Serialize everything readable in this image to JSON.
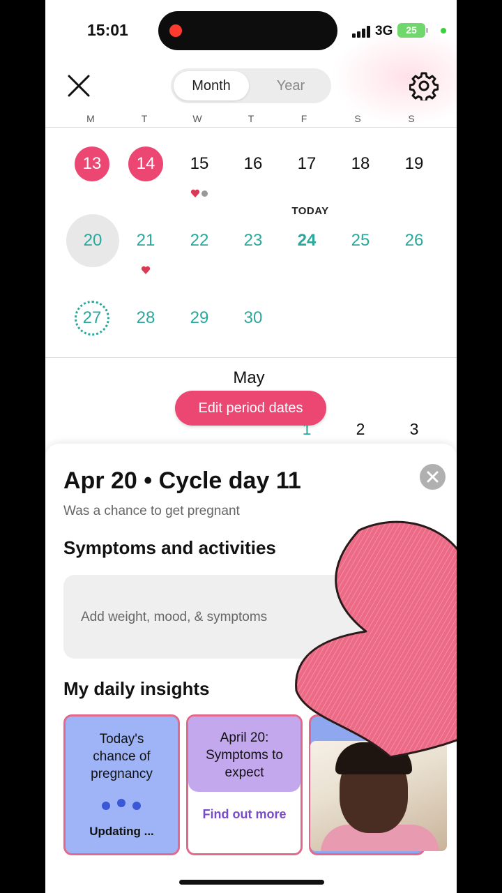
{
  "status": {
    "time": "15:01",
    "network": "3G",
    "battery": "25"
  },
  "header": {
    "close_icon": "close-icon",
    "tabs": [
      "Month",
      "Year"
    ],
    "active_tab": "Month",
    "settings_icon": "gear-icon"
  },
  "weekdays": [
    "M",
    "T",
    "W",
    "T",
    "F",
    "S",
    "S"
  ],
  "calendar": {
    "today_label": "TODAY",
    "row1": [
      "13",
      "14",
      "15",
      "16",
      "17",
      "18",
      "19"
    ],
    "row2": [
      "20",
      "21",
      "22",
      "23",
      "24",
      "25",
      "26"
    ],
    "row3": [
      "27",
      "28",
      "29",
      "30"
    ]
  },
  "next_month": {
    "label": "May",
    "days": [
      "1",
      "2",
      "3"
    ]
  },
  "edit_button": "Edit period dates",
  "sheet": {
    "title": "Apr 20 • Cycle day 11",
    "subtitle": "Was a chance to get pregnant",
    "symptoms_heading": "Symptoms and activities",
    "add_prompt": "Add weight, mood, & symptoms",
    "insights_heading": "My daily insights",
    "card1": {
      "line1": "Today's",
      "line2": "chance of",
      "line3": "pregnancy",
      "status": "Updating ..."
    },
    "card2": {
      "line1": "April 20:",
      "line2": "Symptoms to",
      "line3": "expect",
      "link": "Find out more"
    }
  },
  "colors": {
    "period": "#ec4673",
    "fertile": "#2aa99b",
    "card_blue": "#9fb4f7",
    "card_purple": "#c4a8ee"
  }
}
